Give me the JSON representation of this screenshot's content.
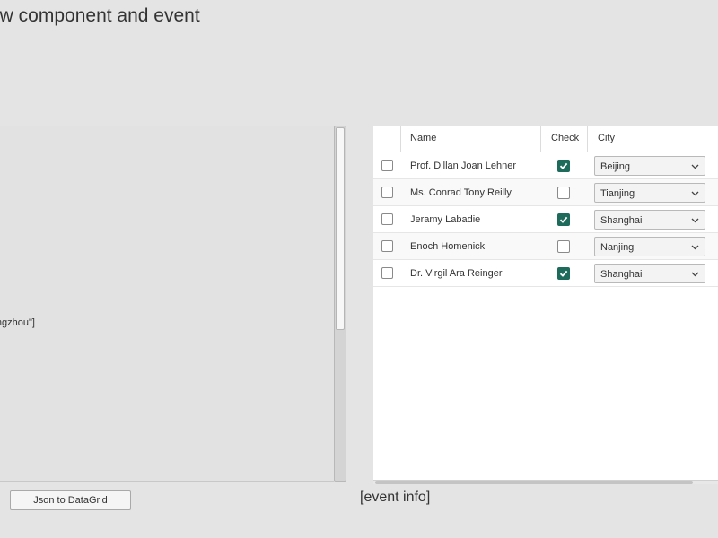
{
  "page": {
    "title": "ow component and event"
  },
  "json_editor": {
    "visible_text": "jing\",\"Tianjing\",\"Nanjing\",\"Guangzhou\"]"
  },
  "grid": {
    "columns": {
      "name": "Name",
      "check": "Check",
      "city": "City"
    },
    "rows": [
      {
        "name": "Prof. Dillan Joan Lehner",
        "checked": true,
        "city": "Beijing"
      },
      {
        "name": "Ms. Conrad Tony Reilly",
        "checked": false,
        "city": "Tianjing"
      },
      {
        "name": "Jeramy Labadie",
        "checked": true,
        "city": "Shanghai"
      },
      {
        "name": "Enoch Homenick",
        "checked": false,
        "city": "Nanjing"
      },
      {
        "name": "Dr. Virgil Ara Reinger",
        "checked": true,
        "city": "Shanghai"
      }
    ]
  },
  "toolbar": {
    "json_to_grid_label": "Json to DataGrid"
  },
  "event": {
    "info_text": "[event info]"
  },
  "colors": {
    "accent": "#1e6b5c",
    "background": "#e4e4e4"
  }
}
